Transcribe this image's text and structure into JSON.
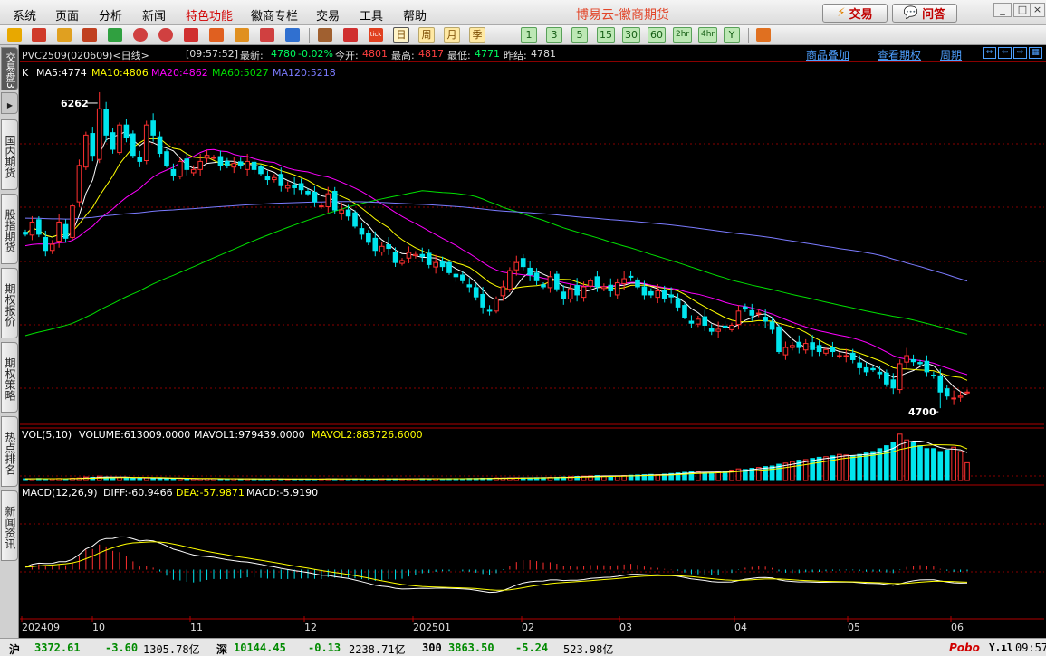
{
  "menu": {
    "items": [
      "系统",
      "页面",
      "分析",
      "新闻",
      "特色功能",
      "徽商专栏",
      "交易",
      "工具",
      "帮助"
    ],
    "highlight_index": 4
  },
  "brand": "博易云-徽商期货",
  "buttons": {
    "trade": "交易",
    "ask": "问答"
  },
  "window_controls": [
    "_",
    "□",
    "×"
  ],
  "toolbar": {
    "periods": [
      "日",
      "周",
      "月",
      "季",
      "1",
      "3",
      "5",
      "15",
      "30",
      "60",
      "2hr",
      "4hr",
      "Y"
    ],
    "active_period": "日"
  },
  "left_tabs": {
    "top": "交易盘3",
    "items": [
      "国内期货",
      "股指期货",
      "期权报价",
      "期权策略",
      "热点排名",
      "新闻资讯"
    ]
  },
  "info": {
    "symbol": "PVC2509(020609)<日线>",
    "time": "[09:57:52]",
    "last_label": "最新:",
    "last": "4780",
    "change": "-0.02%",
    "open_label": "今开:",
    "open": "4801",
    "high_label": "最高:",
    "high": "4817",
    "low_label": "最低:",
    "low": "4771",
    "prev_label": "昨结:",
    "prev": "4781",
    "links": [
      "商品叠加",
      "查看期权",
      "周期"
    ]
  },
  "colors": {
    "up": "#ff3030",
    "down": "#00e5ee",
    "ma5": "#ffffff",
    "ma10": "#ffff00",
    "ma20": "#ff00ff",
    "ma60": "#00e000",
    "ma120": "#7b7bff",
    "grid": "#880000",
    "axis": "#b00000"
  },
  "chart_data": {
    "type": "candlestick",
    "symbol": "PVC2509",
    "period": "日线",
    "x": [
      "202409",
      "10",
      "11",
      "12",
      "202501",
      "02",
      "03",
      "04",
      "05",
      "06"
    ],
    "price_range": [
      4620,
      6320
    ],
    "high_marker": {
      "label": "6262",
      "value": 6262
    },
    "low_marker": {
      "label": "4700",
      "value": 4700
    },
    "ma_legend": {
      "k": "K",
      "ma5": "MA5:4774",
      "ma10": "MA10:4806",
      "ma20": "MA20:4862",
      "ma60": "MA60:5027",
      "ma120": "MA120:5218"
    },
    "volume_legend": {
      "name": "VOL(5,10)",
      "volume": "VOLUME:613009.0000",
      "mavol1": "MAVOL1:979439.0000",
      "mavol2": "MAVOL2:883726.6000"
    },
    "macd_legend": {
      "name": "MACD(12,26,9)",
      "diff": "DIFF:-60.9466",
      "dea": "DEA:-57.9871",
      "macd": "MACD:-5.9190"
    },
    "closes": [
      5560,
      5620,
      5560,
      5480,
      5510,
      5620,
      5540,
      5700,
      5900,
      6050,
      5950,
      6180,
      6050,
      5980,
      6100,
      6040,
      5950,
      5920,
      6100,
      6050,
      5960,
      5900,
      5850,
      5920,
      5880,
      5880,
      5920,
      5950,
      5940,
      5900,
      5900,
      5910,
      5900,
      5920,
      5880,
      5860,
      5830,
      5840,
      5800,
      5800,
      5790,
      5780,
      5760,
      5720,
      5700,
      5760,
      5680,
      5680,
      5650,
      5600,
      5560,
      5520,
      5480,
      5500,
      5490,
      5420,
      5430,
      5470,
      5460,
      5450,
      5410,
      5420,
      5400,
      5370,
      5350,
      5330,
      5300,
      5250,
      5200,
      5180,
      5240,
      5300,
      5380,
      5420,
      5400,
      5360,
      5330,
      5300,
      5350,
      5290,
      5240,
      5290,
      5260,
      5300,
      5330,
      5300,
      5300,
      5280,
      5320,
      5340,
      5350,
      5300,
      5260,
      5260,
      5280,
      5240,
      5250,
      5200,
      5150,
      5120,
      5140,
      5110,
      5080,
      5090,
      5100,
      5110,
      5180,
      5190,
      5160,
      5170,
      5130,
      5090,
      4980,
      5000,
      5010,
      5000,
      5020,
      4990,
      4980,
      4990,
      4980,
      4960,
      4960,
      4940,
      4900,
      4880,
      4890,
      4870,
      4820,
      4800,
      4920,
      4960,
      4930,
      4920,
      4880,
      4860,
      4780,
      4760,
      4750,
      4760,
      4780
    ],
    "volume_scale": 2500000,
    "volumes": [
      60000,
      60000,
      70000,
      60000,
      55000,
      70000,
      60000,
      80000,
      90000,
      120000,
      110000,
      150000,
      120000,
      100000,
      110000,
      100000,
      90000,
      80000,
      90000,
      90000,
      80000,
      70000,
      60000,
      70000,
      65000,
      60000,
      60000,
      65000,
      60000,
      55000,
      55000,
      60000,
      55000,
      60000,
      55000,
      50000,
      50000,
      55000,
      50000,
      50000,
      50000,
      50000,
      50000,
      50000,
      55000,
      60000,
      55000,
      50000,
      50000,
      55000,
      50000,
      50000,
      50000,
      55000,
      55000,
      60000,
      60000,
      60000,
      60000,
      65000,
      60000,
      60000,
      60000,
      65000,
      65000,
      65000,
      70000,
      70000,
      80000,
      80000,
      90000,
      85000,
      90000,
      95000,
      90000,
      95000,
      100000,
      100000,
      110000,
      110000,
      120000,
      130000,
      140000,
      150000,
      160000,
      170000,
      160000,
      150000,
      160000,
      170000,
      180000,
      190000,
      200000,
      210000,
      200000,
      220000,
      240000,
      260000,
      280000,
      320000,
      300000,
      260000,
      280000,
      300000,
      320000,
      360000,
      400000,
      380000,
      420000,
      450000,
      480000,
      500000,
      560000,
      600000,
      650000,
      700000,
      720000,
      760000,
      800000,
      820000,
      850000,
      900000,
      880000,
      860000,
      900000,
      950000,
      1000000,
      1100000,
      1200000,
      1300000,
      1600000,
      1400000,
      1300000,
      1200000,
      1100000,
      1100000,
      1000000,
      1050000,
      1150000,
      1000000,
      613009
    ],
    "macd_range": [
      -260,
      360
    ]
  },
  "status": {
    "sh_label": "沪",
    "sh_index": "3372.61",
    "sh_change": "-3.60",
    "sh_amount": "1305.78亿",
    "sz_label": "深",
    "sz_index": "10144.45",
    "sz_change": "-0.13",
    "sz_amount": "2238.71亿",
    "i300_label": "300",
    "i300_index": "3863.50",
    "i300_change": "-5.24",
    "i300_amount": "523.98亿",
    "logo": "Pobo",
    "signal": "Y.ıl",
    "clock": "09:57"
  }
}
